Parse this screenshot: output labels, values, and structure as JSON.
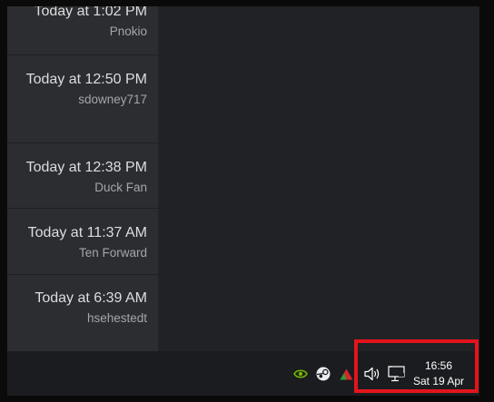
{
  "notifications": [
    {
      "time": "Today at 1:02 PM",
      "author": "Pnokio"
    },
    {
      "time": "Today at 12:50 PM",
      "author": "sdowney717"
    },
    {
      "time": "Today at 12:38 PM",
      "author": "Duck Fan"
    },
    {
      "time": "Today at 11:37 AM",
      "author": "Ten Forward"
    },
    {
      "time": "Today at 6:39 AM",
      "author": "hsehestedt"
    }
  ],
  "taskbar": {
    "tray_icons": [
      "nvidia-icon",
      "steam-icon",
      "triangle-app-icon",
      "volume-icon",
      "network-icon"
    ],
    "clock_time": "16:56",
    "clock_date": "Sat 19 Apr"
  },
  "colors": {
    "highlight": "#e3141c",
    "nvidia": "#76b900",
    "app_red": "#d8242a"
  }
}
